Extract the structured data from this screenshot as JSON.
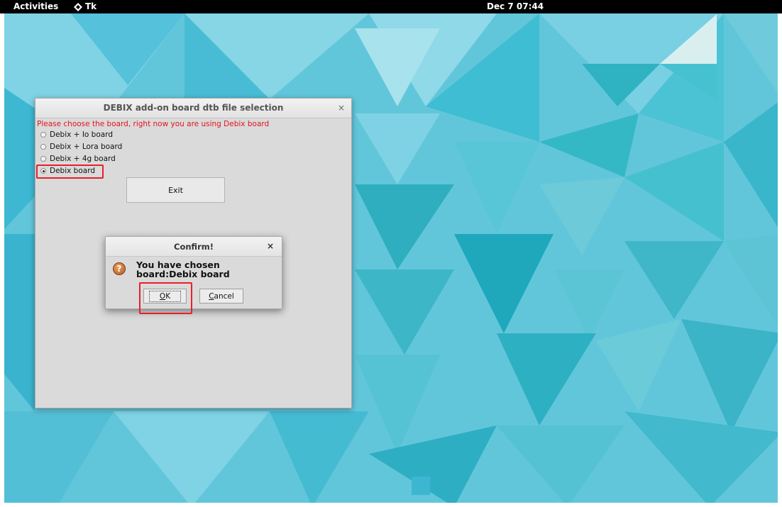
{
  "topbar": {
    "activities_label": "Activities",
    "app_name": "Tk",
    "clock": "Dec 7 07:44"
  },
  "main_window": {
    "title": "DEBIX add-on board dtb file selection",
    "close_glyph": "×",
    "instruction": "Please choose the board, right now you are using Debix board",
    "options": [
      {
        "label": "Debix + Io board",
        "checked": false
      },
      {
        "label": "Debix + Lora board",
        "checked": false
      },
      {
        "label": "Debix + 4g board",
        "checked": false
      },
      {
        "label": "Debix board",
        "checked": true
      }
    ],
    "exit_label": "Exit"
  },
  "confirm_dialog": {
    "title": "Confirm!",
    "close_glyph": "×",
    "icon": "question-icon",
    "message": "You have chosen board:Debix board",
    "ok_mnemonic": "O",
    "ok_rest": "K",
    "cancel_mnemonic": "C",
    "cancel_rest": "ancel"
  },
  "colors": {
    "topbar_bg": "#000000",
    "instruction_text": "#e8111e",
    "highlight_box": "#e8202a",
    "window_bg": "#dadada"
  }
}
